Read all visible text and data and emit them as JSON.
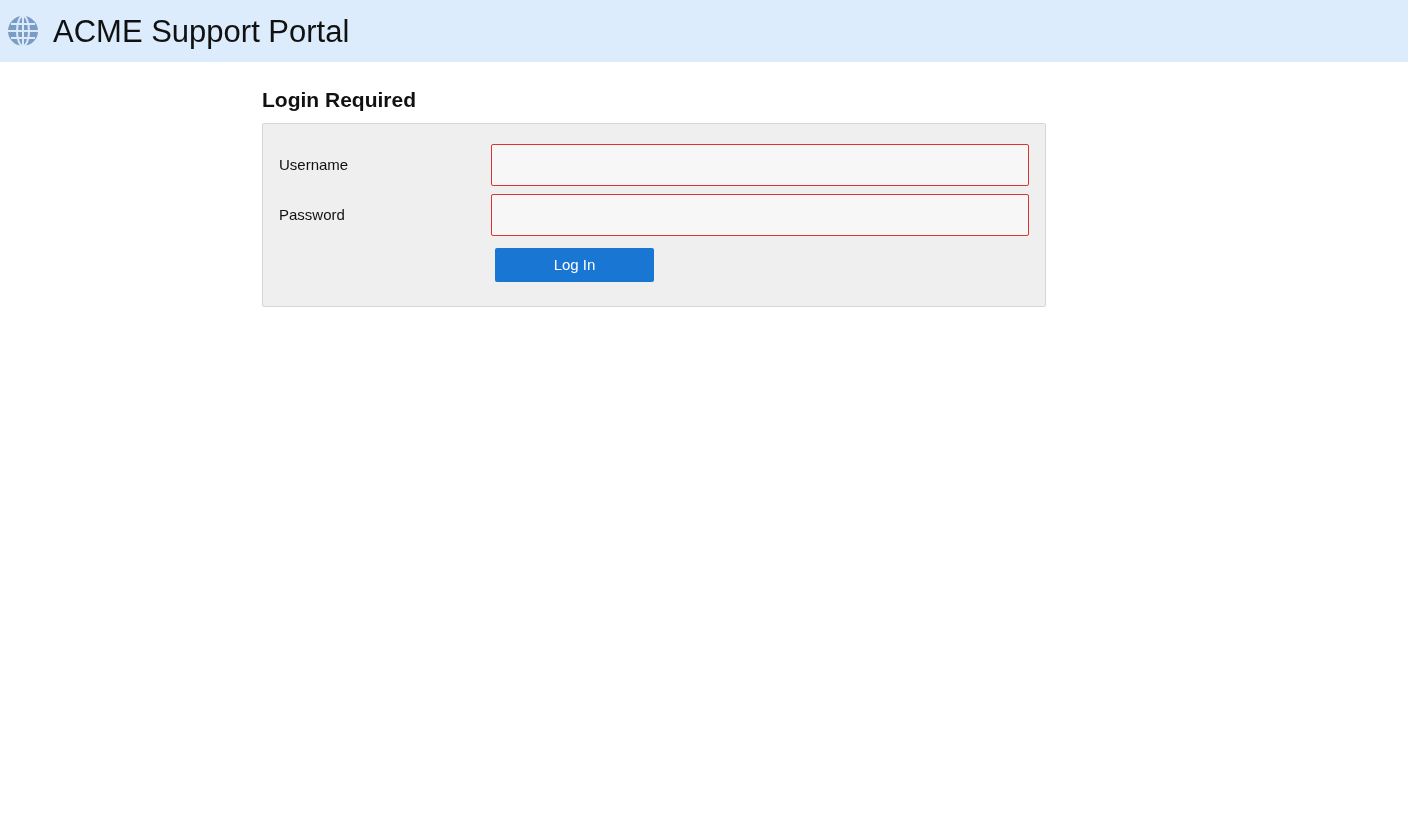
{
  "header": {
    "title": "ACME Support Portal"
  },
  "login": {
    "heading": "Login Required",
    "fields": [
      {
        "label": "Username",
        "invalid": true
      },
      {
        "label": "Password",
        "invalid": true
      }
    ],
    "button": "Log In"
  }
}
